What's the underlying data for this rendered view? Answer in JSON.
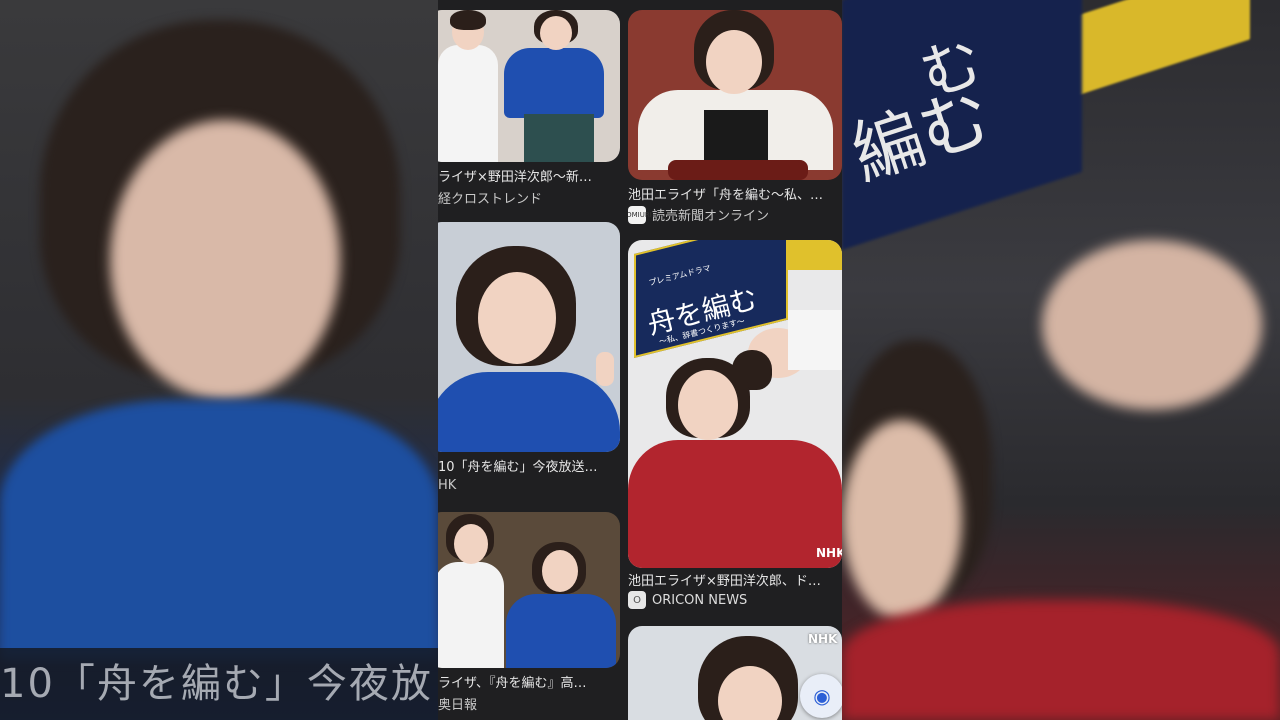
{
  "left_panel": {
    "caption": "10「舟を編む」今夜放"
  },
  "right_panel": {
    "poster_text_1": "編む",
    "poster_text_2": "む"
  },
  "results": [
    {
      "caption": "ライザ×野田洋次郎〜新…",
      "source": "経クロストレンド",
      "source_icon": ""
    },
    {
      "caption": "池田エライザ「舟を編む〜私、…",
      "source": "読売新聞オンライン",
      "source_icon": "YOMIURI"
    },
    {
      "caption": "10「舟を編む」今夜放送…",
      "source": "HK",
      "source_icon": ""
    },
    {
      "caption": "池田エライザ×野田洋次郎、ド…",
      "source": "ORICON NEWS",
      "source_icon": "O"
    },
    {
      "caption": "ライザ、『舟を編む』高…",
      "source": "奥日報",
      "source_icon": ""
    }
  ],
  "poster": {
    "series": "プレミアムドラマ",
    "title": "舟を編む",
    "subtitle": "〜私、辞書つくります〜",
    "network": "NHK"
  },
  "last_card": {
    "network": "NHK"
  },
  "lens_button": {
    "icon": "lens-icon"
  }
}
